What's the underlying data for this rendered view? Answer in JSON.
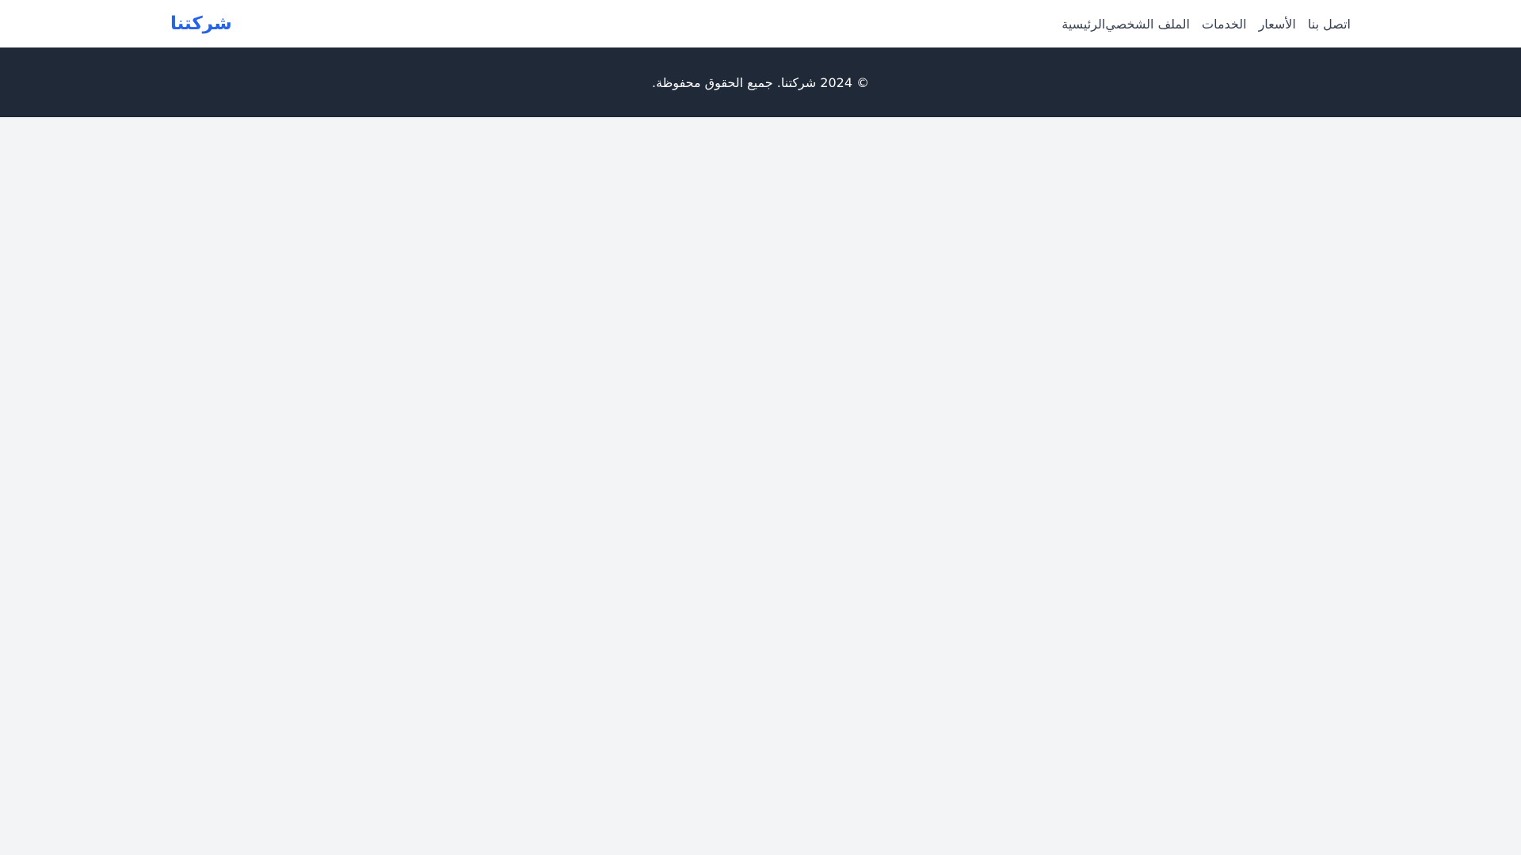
{
  "colors": {
    "brand": "#2563eb",
    "nav_background": "#ffffff",
    "nav_text": "#374151",
    "footer_background": "#1f2937",
    "footer_text": "#ffffff",
    "page_background": "#f3f4f6"
  },
  "navbar": {
    "brand": "شركتنا",
    "links": [
      {
        "label": "الرئيسية"
      },
      {
        "label": "الملف الشخصي"
      },
      {
        "label": "الخدمات"
      },
      {
        "label": "الأسعار"
      },
      {
        "label": "اتصل بنا"
      }
    ]
  },
  "footer": {
    "copyright": "© 2024 شركتنا. جميع الحقوق محفوظة."
  }
}
